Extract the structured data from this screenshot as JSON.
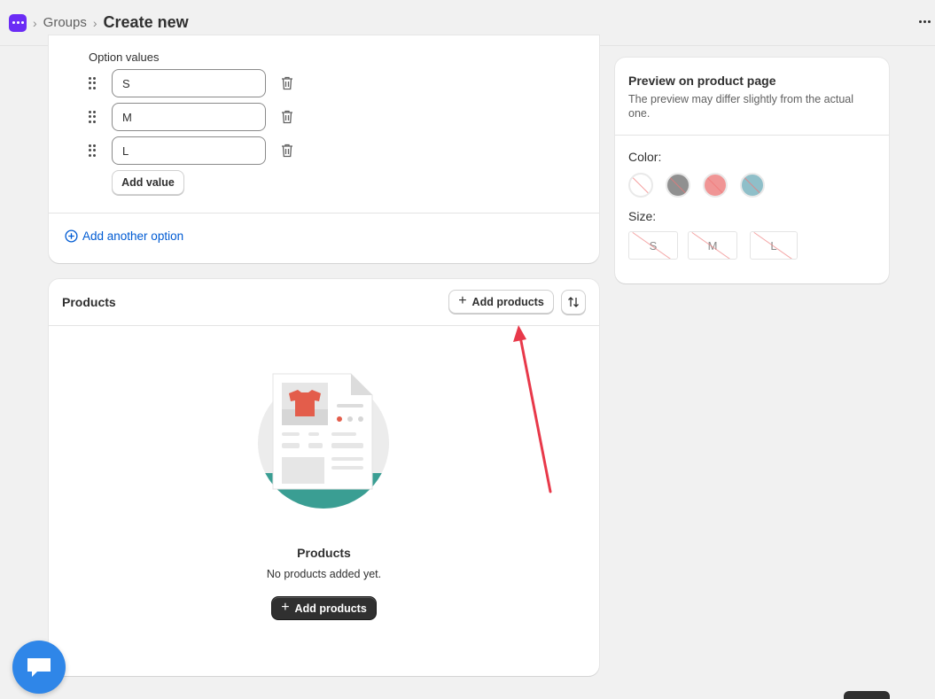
{
  "breadcrumb": {
    "parent": "Groups",
    "current": "Create new",
    "separator": "›"
  },
  "option_values": {
    "label": "Option values",
    "values": [
      "S",
      "M",
      "L"
    ],
    "add_value_label": "Add value",
    "add_another_option_label": "Add another option"
  },
  "products": {
    "title": "Products",
    "add_button_label": "Add products",
    "empty_title": "Products",
    "empty_description": "No products added yet.",
    "empty_button_label": "Add products"
  },
  "preview": {
    "title": "Preview on product page",
    "subtitle": "The preview may differ slightly from the actual one.",
    "color_label": "Color:",
    "colors": [
      "#ffffff",
      "#909090",
      "#f09595",
      "#8fbfc9"
    ],
    "size_label": "Size:",
    "sizes": [
      "S",
      "M",
      "L"
    ]
  },
  "colors": {
    "accent": "#005bd3",
    "primary_button": "#303030",
    "annotation_arrow": "#e8394a",
    "chat": "#2f86e8"
  }
}
